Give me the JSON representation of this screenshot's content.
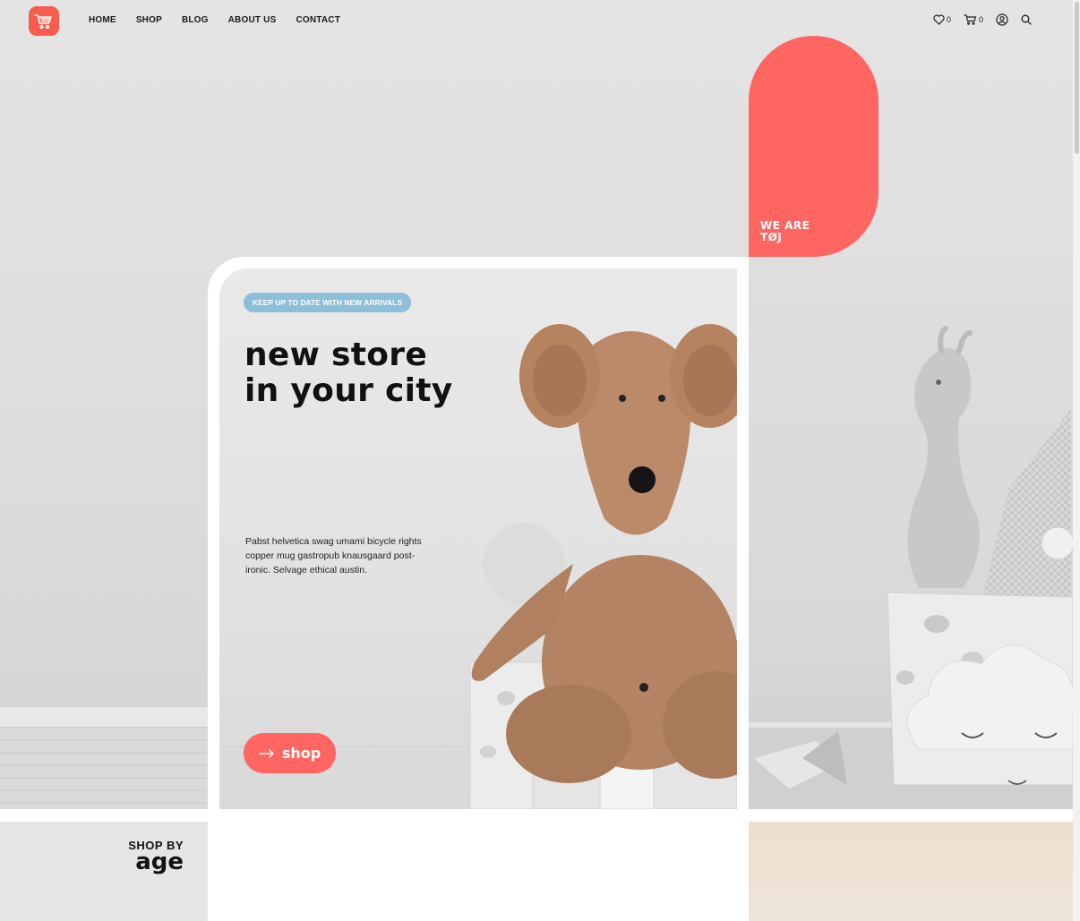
{
  "header": {
    "nav": [
      "Home",
      "Shop",
      "Blog",
      "About us",
      "Contact"
    ],
    "wishlist_count": "0",
    "cart_count": "0"
  },
  "hero": {
    "pill_text_line1": "WE ARE",
    "pill_text_line2": "TØJ",
    "badge": "keep up to date with new arrivals",
    "headline_line1": "new store",
    "headline_line2": "in your city",
    "description": "Pabst helvetica swag umami bicycle rights copper mug gastropub knausgaard post-ironic. Selvage ethical austin.",
    "button_label": "shop"
  },
  "sections": {
    "age_top": "SHOP BY",
    "age_big": "age"
  },
  "colors": {
    "accent": "#ff6561",
    "badge": "#8dbfd8",
    "logo": "#f75c4c"
  }
}
